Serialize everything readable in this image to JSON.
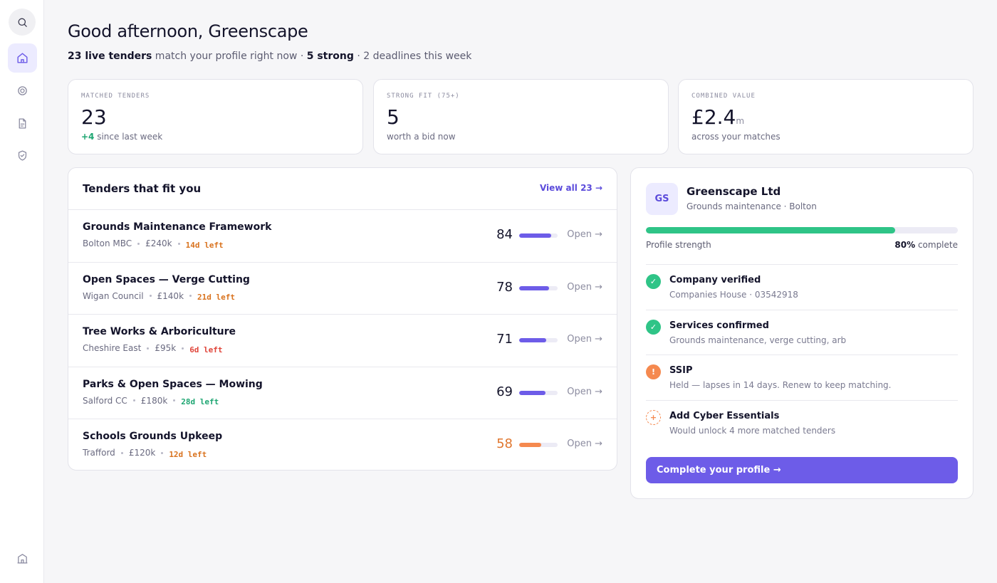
{
  "sidebar": {
    "items": [
      {
        "icon": "search-icon"
      },
      {
        "icon": "home-icon",
        "active": true
      },
      {
        "icon": "target-icon"
      },
      {
        "icon": "document-icon"
      },
      {
        "icon": "shield-check-icon"
      },
      {
        "icon": "building-icon"
      }
    ]
  },
  "header": {
    "greeting": "Good afternoon, Greenscape",
    "live_count": "23 live tenders",
    "match_text": " match your profile right now · ",
    "strong_count": "5 strong",
    "deadline_text": " · 2 deadlines this week"
  },
  "stats": [
    {
      "label": "MATCHED TENDERS",
      "value": "23",
      "unit": "",
      "delta": "+4",
      "note": " since last week"
    },
    {
      "label": "STRONG FIT (75+)",
      "value": "5",
      "unit": "",
      "delta": "",
      "note": "worth a bid now"
    },
    {
      "label": "COMBINED VALUE",
      "value": "£2.4",
      "unit": "m",
      "delta": "",
      "note": "across your matches"
    }
  ],
  "tenders": {
    "title": "Tenders that fit you",
    "view_all": "View all 23 →",
    "open_label": "Open →",
    "rows": [
      {
        "title": "Grounds Maintenance Framework",
        "buyer": "Bolton MBC",
        "value": "£240k",
        "deadline": "14d left",
        "deadline_color": "#d9731f",
        "score": "84",
        "fit": 0.84,
        "bar_color": "#6d5ce8",
        "score_color": "#14142b"
      },
      {
        "title": "Open Spaces — Verge Cutting",
        "buyer": "Wigan Council",
        "value": "£140k",
        "deadline": "21d left",
        "deadline_color": "#d9731f",
        "score": "78",
        "fit": 0.78,
        "bar_color": "#6d5ce8",
        "score_color": "#14142b"
      },
      {
        "title": "Tree Works & Arboriculture",
        "buyer": "Cheshire East",
        "value": "£95k",
        "deadline": "6d left",
        "deadline_color": "#e0453a",
        "score": "71",
        "fit": 0.71,
        "bar_color": "#6d5ce8",
        "score_color": "#14142b"
      },
      {
        "title": "Parks & Open Spaces — Mowing",
        "buyer": "Salford CC",
        "value": "£180k",
        "deadline": "28d left",
        "deadline_color": "#1ea672",
        "score": "69",
        "fit": 0.69,
        "bar_color": "#6d5ce8",
        "score_color": "#14142b"
      },
      {
        "title": "Schools Grounds Upkeep",
        "buyer": "Trafford",
        "value": "£120k",
        "deadline": "12d left",
        "deadline_color": "#d9731f",
        "score": "58",
        "fit": 0.58,
        "bar_color": "#f5894f",
        "score_color": "#e0762e"
      }
    ]
  },
  "profile": {
    "initials": "GS",
    "name": "Greenscape Ltd",
    "subtitle": "Grounds maintenance · Bolton",
    "strength_label": "Profile strength",
    "strength_pct": "80%",
    "strength_suffix": " complete",
    "strength": 0.8,
    "checklist": [
      {
        "status": "done",
        "glyph": "✓",
        "title": "Company verified",
        "sub": "Companies House · 03542918"
      },
      {
        "status": "done",
        "glyph": "✓",
        "title": "Services confirmed",
        "sub": "Grounds maintenance, verge cutting, arb"
      },
      {
        "status": "warn",
        "glyph": "!",
        "title": "SSIP",
        "sub": "Held — lapses in 14 days. Renew to keep matching."
      },
      {
        "status": "add",
        "glyph": "+",
        "title": "Add Cyber Essentials",
        "sub": "Would unlock 4 more matched tenders"
      }
    ],
    "cta": "Complete your profile →"
  }
}
